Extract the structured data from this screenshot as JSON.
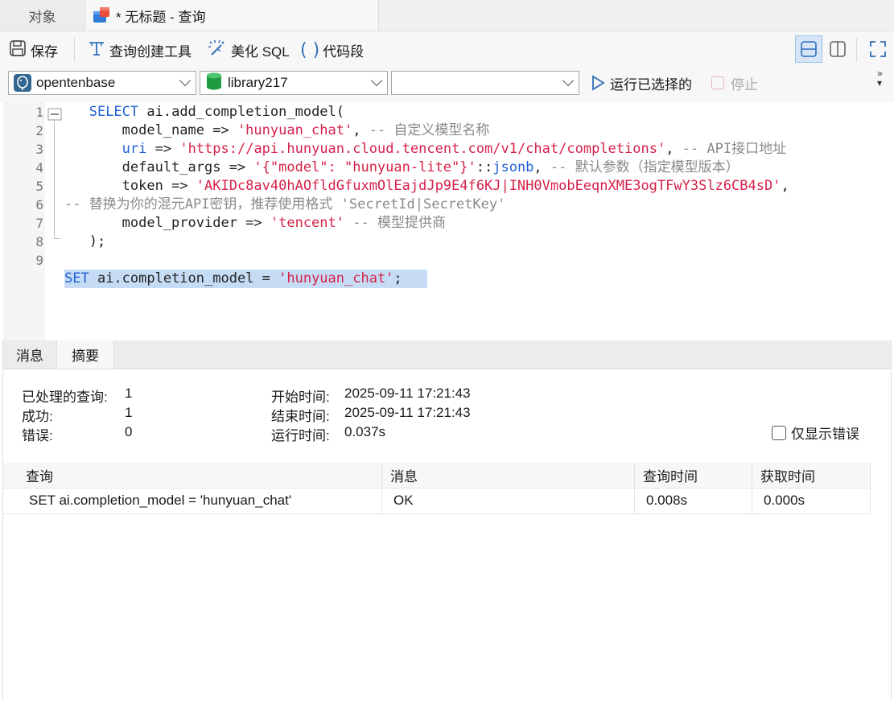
{
  "tabs": {
    "objects": "对象",
    "query": "* 无标题 - 查询"
  },
  "toolbar": {
    "save": "保存",
    "query_builder": "查询创建工具",
    "beautify": "美化 SQL",
    "snippet": "代码段"
  },
  "selectors": {
    "connection": "opentenbase",
    "database": "library217",
    "schema": "",
    "run_selected": "运行已选择的",
    "stop": "停止"
  },
  "editor": {
    "line_numbers": [
      "1",
      "2",
      "3",
      "4",
      "5",
      "6",
      "7",
      "8",
      "9"
    ],
    "lines": [
      {
        "parts": [
          {
            "t": "   ",
            "c": "pl"
          },
          {
            "t": "SELECT",
            "c": "kw"
          },
          {
            "t": " ai.add_completion_model(",
            "c": "pl"
          }
        ]
      },
      {
        "parts": [
          {
            "t": "       model_name => ",
            "c": "pl"
          },
          {
            "t": "'hunyuan_chat'",
            "c": "str"
          },
          {
            "t": ", ",
            "c": "pl"
          },
          {
            "t": "-- 自定义模型名称",
            "c": "cm"
          }
        ]
      },
      {
        "parts": [
          {
            "t": "       ",
            "c": "pl"
          },
          {
            "t": "uri",
            "c": "kw"
          },
          {
            "t": " => ",
            "c": "pl"
          },
          {
            "t": "'https://api.hunyuan.cloud.tencent.com/v1/chat/completions'",
            "c": "str"
          },
          {
            "t": ", ",
            "c": "pl"
          },
          {
            "t": "-- API接口地址",
            "c": "cm"
          }
        ]
      },
      {
        "parts": [
          {
            "t": "       default_args => ",
            "c": "pl"
          },
          {
            "t": "'{\"model\": \"hunyuan-lite\"}'",
            "c": "str"
          },
          {
            "t": "::",
            "c": "pl"
          },
          {
            "t": "jsonb",
            "c": "kw"
          },
          {
            "t": ", ",
            "c": "pl"
          },
          {
            "t": "-- 默认参数（指定模型版本）",
            "c": "cm"
          }
        ]
      },
      {
        "parts": [
          {
            "t": "       token => ",
            "c": "pl"
          },
          {
            "t": "'AKIDc8av40hAOfldGfuxmOlEajdJp9E4f6KJ|INH0VmobEeqnXME3ogTFwY3Slz6CB4sD'",
            "c": "str"
          },
          {
            "t": ",",
            "c": "pl"
          }
        ]
      },
      {
        "parts": [
          {
            "t": "-- 替换为你的混元API密钥，推荐使用格式 'SecretId|SecretKey'",
            "c": "cm"
          }
        ]
      },
      {
        "parts": [
          {
            "t": "       model_provider => ",
            "c": "pl"
          },
          {
            "t": "'tencent'",
            "c": "str"
          },
          {
            "t": " ",
            "c": "pl"
          },
          {
            "t": "-- 模型提供商",
            "c": "cm"
          }
        ]
      },
      {
        "parts": [
          {
            "t": "   );",
            "c": "pl"
          }
        ]
      },
      {
        "parts": [
          {
            "t": "",
            "c": "pl"
          }
        ]
      },
      {
        "parts": [
          {
            "t": "SET",
            "c": "kw"
          },
          {
            "t": " ai.completion_model = ",
            "c": "pl"
          },
          {
            "t": "'hunyuan_chat'",
            "c": "str"
          },
          {
            "t": ";",
            "c": "pl"
          }
        ]
      }
    ]
  },
  "result_tabs": {
    "messages": "消息",
    "summary": "摘要"
  },
  "summary": {
    "processed_label": "已处理的查询:",
    "processed_value": "1",
    "success_label": "成功:",
    "success_value": "1",
    "error_label": "错误:",
    "error_value": "0",
    "start_label": "开始时间:",
    "start_value": "2025-09-11 17:21:43",
    "end_label": "结束时间:",
    "end_value": "2025-09-11 17:21:43",
    "runtime_label": "运行时间:",
    "runtime_value": "0.037s",
    "errors_only": "仅显示错误"
  },
  "grid": {
    "headers": [
      "查询",
      "消息",
      "查询时间",
      "获取时间"
    ],
    "rows": [
      [
        "SET ai.completion_model = 'hunyuan_chat'",
        "OK",
        "0.008s",
        "0.000s"
      ]
    ]
  }
}
